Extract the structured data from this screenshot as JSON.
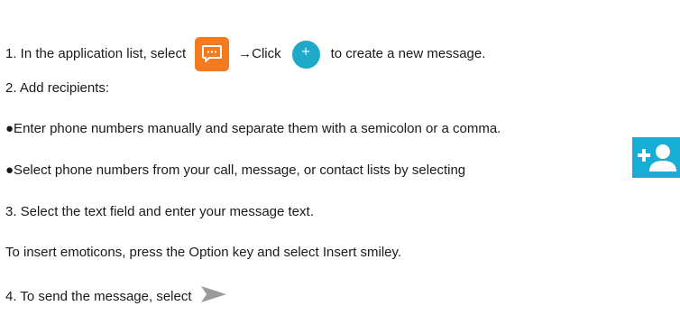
{
  "steps": {
    "step1": {
      "prefix": "1. In the application list, select",
      "arrow_click": "→Click",
      "suffix": "to create a new message."
    },
    "step2": "2. Add recipients:",
    "bullet_manual": "●Enter phone numbers manually and separate them with a semicolon or a comma.",
    "bullet_select": "●Select phone numbers from your call, message, or contact lists by selecting",
    "step3": "3. Select the text field and enter your message text.",
    "emoticons": "To insert emoticons, press the Option key and select Insert smiley.",
    "step4": "4. To send the message, select"
  },
  "icons": {
    "messaging_app": "messaging-app-icon",
    "new_message": "plus-icon",
    "add_contact": "add-contact-icon",
    "send": "send-icon"
  },
  "colors": {
    "messaging_app": "#f47a20",
    "new_message": "#1fa9c9",
    "add_contact": "#16aed5",
    "send": "#9b9b9b"
  }
}
